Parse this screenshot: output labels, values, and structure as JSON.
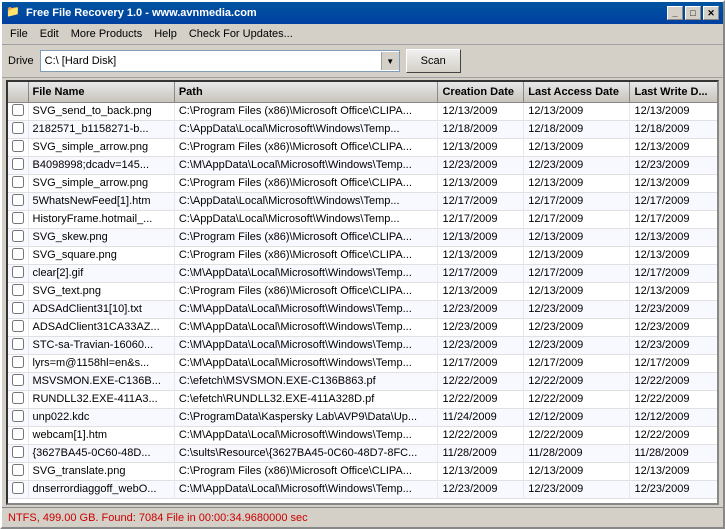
{
  "window": {
    "title": "Free File Recovery 1.0  -  www.avnmedia.com",
    "icon": "📁"
  },
  "titlebar": {
    "minimize_label": "_",
    "maximize_label": "□",
    "close_label": "✕"
  },
  "menu": {
    "items": [
      {
        "label": "File",
        "id": "file"
      },
      {
        "label": "Edit",
        "id": "edit"
      },
      {
        "label": "More Products",
        "id": "more-products"
      },
      {
        "label": "Help",
        "id": "help"
      },
      {
        "label": "Check For Updates...",
        "id": "check-updates"
      }
    ]
  },
  "toolbar": {
    "drive_label": "Drive",
    "drive_value": "C:\\ [Hard Disk]",
    "scan_label": "Scan"
  },
  "table": {
    "columns": [
      {
        "id": "check",
        "label": ""
      },
      {
        "id": "filename",
        "label": "File Name"
      },
      {
        "id": "path",
        "label": "Path"
      },
      {
        "id": "creation",
        "label": "Creation Date"
      },
      {
        "id": "access",
        "label": "Last Access Date"
      },
      {
        "id": "write",
        "label": "Last Write D..."
      }
    ],
    "rows": [
      {
        "filename": "SVG_send_to_back.png",
        "path": "C:\\Program Files (x86)\\Microsoft Office\\CLIPA...",
        "creation": "12/13/2009",
        "access": "12/13/2009",
        "write": "12/13/2009"
      },
      {
        "filename": "2182571_b1158271-b...",
        "path": "C:\\AppData\\Local\\Microsoft\\Windows\\Temp...",
        "creation": "12/18/2009",
        "access": "12/18/2009",
        "write": "12/18/2009"
      },
      {
        "filename": "SVG_simple_arrow.png",
        "path": "C:\\Program Files (x86)\\Microsoft Office\\CLIPA...",
        "creation": "12/13/2009",
        "access": "12/13/2009",
        "write": "12/13/2009"
      },
      {
        "filename": "B4098998;dcadv=145...",
        "path": "C:\\M\\AppData\\Local\\Microsoft\\Windows\\Temp...",
        "creation": "12/23/2009",
        "access": "12/23/2009",
        "write": "12/23/2009"
      },
      {
        "filename": "SVG_simple_arrow.png",
        "path": "C:\\Program Files (x86)\\Microsoft Office\\CLIPA...",
        "creation": "12/13/2009",
        "access": "12/13/2009",
        "write": "12/13/2009"
      },
      {
        "filename": "5WhatsNewFeed[1].htm",
        "path": "C:\\AppData\\Local\\Microsoft\\Windows\\Temp...",
        "creation": "12/17/2009",
        "access": "12/17/2009",
        "write": "12/17/2009"
      },
      {
        "filename": "HistoryFrame.hotmail_...",
        "path": "C:\\AppData\\Local\\Microsoft\\Windows\\Temp...",
        "creation": "12/17/2009",
        "access": "12/17/2009",
        "write": "12/17/2009"
      },
      {
        "filename": "SVG_skew.png",
        "path": "C:\\Program Files (x86)\\Microsoft Office\\CLIPA...",
        "creation": "12/13/2009",
        "access": "12/13/2009",
        "write": "12/13/2009"
      },
      {
        "filename": "SVG_square.png",
        "path": "C:\\Program Files (x86)\\Microsoft Office\\CLIPA...",
        "creation": "12/13/2009",
        "access": "12/13/2009",
        "write": "12/13/2009"
      },
      {
        "filename": "clear[2].gif",
        "path": "C:\\M\\AppData\\Local\\Microsoft\\Windows\\Temp...",
        "creation": "12/17/2009",
        "access": "12/17/2009",
        "write": "12/17/2009"
      },
      {
        "filename": "SVG_text.png",
        "path": "C:\\Program Files (x86)\\Microsoft Office\\CLIPA...",
        "creation": "12/13/2009",
        "access": "12/13/2009",
        "write": "12/13/2009"
      },
      {
        "filename": "ADSAdClient31[10].txt",
        "path": "C:\\M\\AppData\\Local\\Microsoft\\Windows\\Temp...",
        "creation": "12/23/2009",
        "access": "12/23/2009",
        "write": "12/23/2009"
      },
      {
        "filename": "ADSAdClient31CA33AZ...",
        "path": "C:\\M\\AppData\\Local\\Microsoft\\Windows\\Temp...",
        "creation": "12/23/2009",
        "access": "12/23/2009",
        "write": "12/23/2009"
      },
      {
        "filename": "STC-sa-Travian-16060...",
        "path": "C:\\M\\AppData\\Local\\Microsoft\\Windows\\Temp...",
        "creation": "12/23/2009",
        "access": "12/23/2009",
        "write": "12/23/2009"
      },
      {
        "filename": "lyrs=m@1158hl=en&s...",
        "path": "C:\\M\\AppData\\Local\\Microsoft\\Windows\\Temp...",
        "creation": "12/17/2009",
        "access": "12/17/2009",
        "write": "12/17/2009"
      },
      {
        "filename": "MSVSMON.EXE-C136B...",
        "path": "C:\\efetch\\MSVSMON.EXE-C136B863.pf",
        "creation": "12/22/2009",
        "access": "12/22/2009",
        "write": "12/22/2009"
      },
      {
        "filename": "RUNDLL32.EXE-411A3...",
        "path": "C:\\efetch\\RUNDLL32.EXE-411A328D.pf",
        "creation": "12/22/2009",
        "access": "12/22/2009",
        "write": "12/22/2009"
      },
      {
        "filename": "unp022.kdc",
        "path": "C:\\ProgramData\\Kaspersky Lab\\AVP9\\Data\\Up...",
        "creation": "11/24/2009",
        "access": "12/12/2009",
        "write": "12/12/2009"
      },
      {
        "filename": "webcam[1].htm",
        "path": "C:\\M\\AppData\\Local\\Microsoft\\Windows\\Temp...",
        "creation": "12/22/2009",
        "access": "12/22/2009",
        "write": "12/22/2009"
      },
      {
        "filename": "{3627BA45-0C60-48D...",
        "path": "C:\\sults\\Resource\\{3627BA45-0C60-48D7-8FC...",
        "creation": "11/28/2009",
        "access": "11/28/2009",
        "write": "11/28/2009"
      },
      {
        "filename": "SVG_translate.png",
        "path": "C:\\Program Files (x86)\\Microsoft Office\\CLIPA...",
        "creation": "12/13/2009",
        "access": "12/13/2009",
        "write": "12/13/2009"
      },
      {
        "filename": "dnserrordiaggoff_webO...",
        "path": "C:\\M\\AppData\\Local\\Microsoft\\Windows\\Temp...",
        "creation": "12/23/2009",
        "access": "12/23/2009",
        "write": "12/23/2009"
      }
    ]
  },
  "status": {
    "text": "NTFS, 499.00 GB. Found: 7084 File in 00:00:34.9680000 sec"
  }
}
